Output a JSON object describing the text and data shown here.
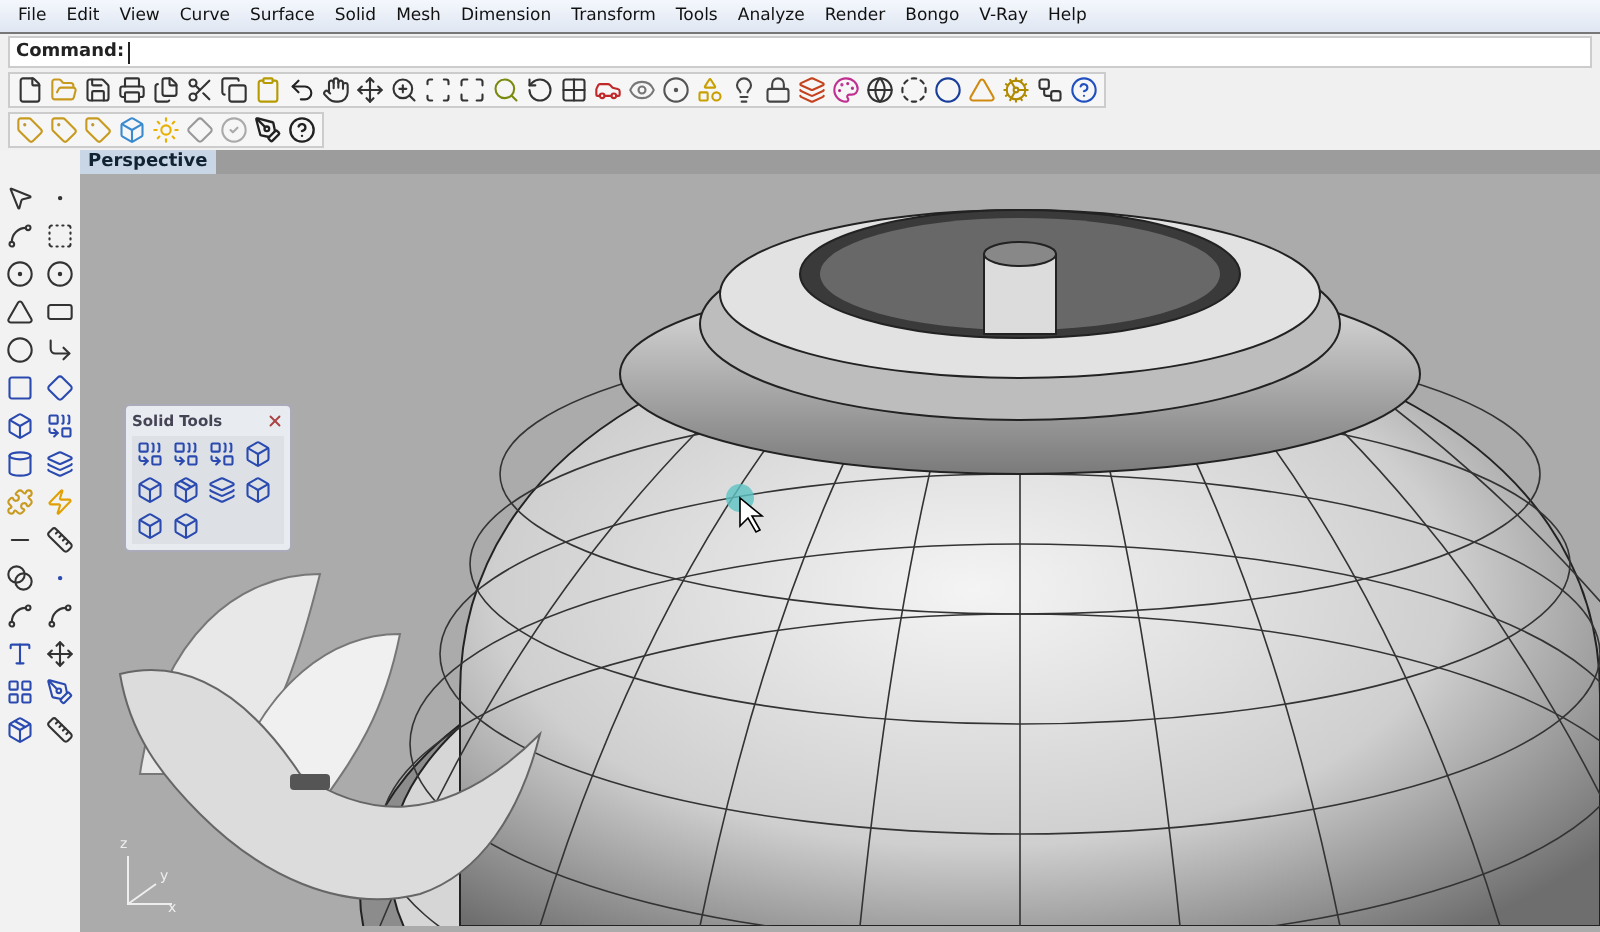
{
  "menu_bar": {
    "items": [
      "File",
      "Edit",
      "View",
      "Curve",
      "Surface",
      "Solid",
      "Mesh",
      "Dimension",
      "Transform",
      "Tools",
      "Analyze",
      "Render",
      "Bongo",
      "V-Ray",
      "Help"
    ]
  },
  "command_line": {
    "label": "Command:"
  },
  "viewport": {
    "tab": "Perspective",
    "axis_labels": [
      "z",
      "y",
      "x"
    ]
  },
  "solid_tools_panel": {
    "title": "Solid Tools"
  }
}
